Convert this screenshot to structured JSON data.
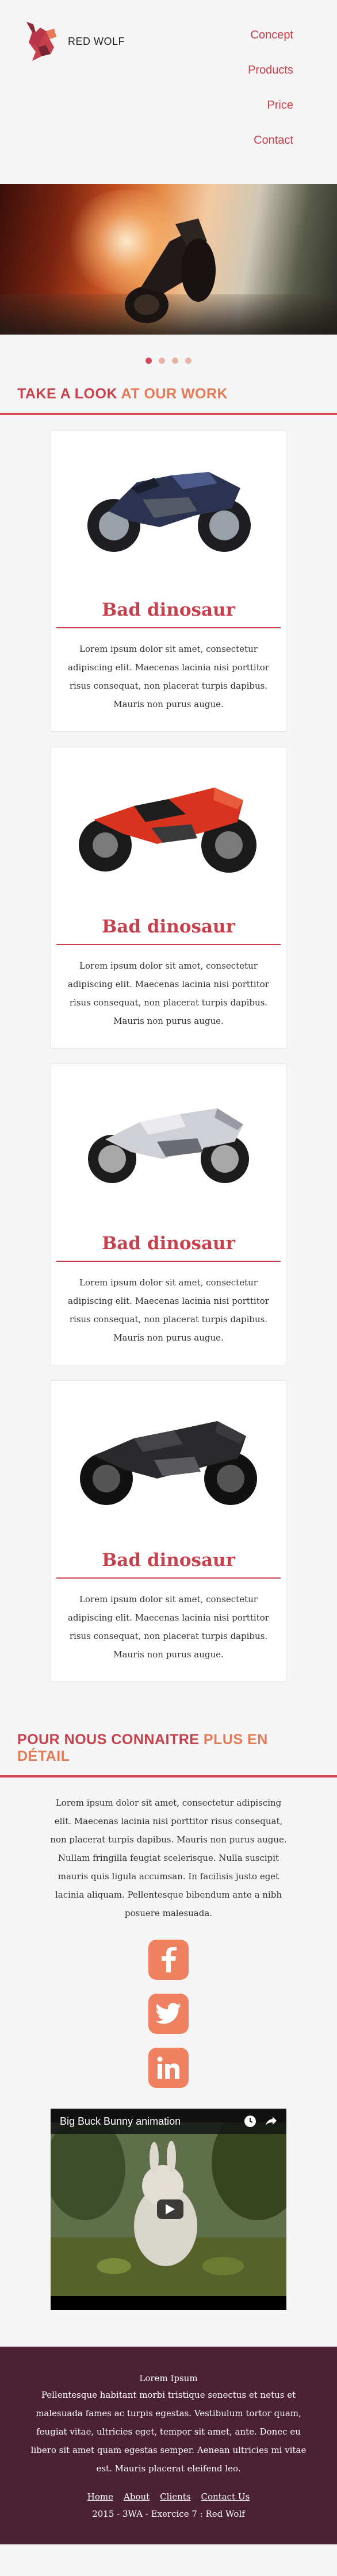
{
  "brand": {
    "name": "RED WOLF"
  },
  "nav": {
    "items": [
      "Concept",
      "Products",
      "Price",
      "Contact"
    ]
  },
  "carousel": {
    "dots": 4,
    "active_index": 0
  },
  "work": {
    "title_main": "TAKE A LOOK",
    "title_accent": "AT OUR WORK",
    "cards": [
      {
        "title": "Bad dinosaur",
        "text": "Lorem ipsum dolor sit amet, consectetur adipiscing elit. Maecenas lacinia nisi porttitor risus consequat, non placerat turpis dapibus. Mauris non purus augue.",
        "bike": "motorcycle-blue"
      },
      {
        "title": "Bad dinosaur",
        "text": "Lorem ipsum dolor sit amet, consectetur adipiscing elit. Maecenas lacinia nisi porttitor risus consequat, non placerat turpis dapibus. Mauris non purus augue.",
        "bike": "motorcycle-red"
      },
      {
        "title": "Bad dinosaur",
        "text": "Lorem ipsum dolor sit amet, consectetur adipiscing elit. Maecenas lacinia nisi porttitor risus consequat, non placerat turpis dapibus. Mauris non purus augue.",
        "bike": "motorcycle-silver"
      },
      {
        "title": "Bad dinosaur",
        "text": "Lorem ipsum dolor sit amet, consectetur adipiscing elit. Maecenas lacinia nisi porttitor risus consequat, non placerat turpis dapibus. Mauris non purus augue.",
        "bike": "motorcycle-black"
      }
    ]
  },
  "about": {
    "title_main": "POUR NOUS CONNAITRE",
    "title_accent": "PLUS EN DÉTAIL",
    "text": "Lorem ipsum dolor sit amet, consectetur adipiscing elit. Maecenas lacinia nisi porttitor risus consequat, non placerat turpis dapibus. Mauris non purus augue.",
    "text2": "Nullam fringilla feugiat scelerisque. Nulla suscipit mauris quis ligula accumsan. In facilisis justo eget lacinia aliquam. Pellentesque bibendum ante a nibh posuere malesuada."
  },
  "social": {
    "icons": [
      "facebook-icon",
      "twitter-icon",
      "linkedin-icon"
    ]
  },
  "video": {
    "title": "Big Buck Bunny animation"
  },
  "footer": {
    "title": "Lorem Ipsum",
    "text": "Pellentesque habitant morbi tristique senectus et netus et malesuada fames ac turpis egestas. Vestibulum tortor quam, feugiat vitae, ultricies eget, tempor sit amet, ante. Donec eu libero sit amet quam egestas semper. Aenean ultricies mi vitae est. Mauris placerat eleifend leo.",
    "links": [
      "Home",
      "About",
      "Clients",
      "Contact Us"
    ],
    "copyright": "2015 - 3WA - Exercice 7 : Red Wolf"
  },
  "colors": {
    "accent": "#c7404b",
    "accent_light": "#e47a56",
    "social": "#ef8060",
    "footer_bg": "#4a2234"
  }
}
